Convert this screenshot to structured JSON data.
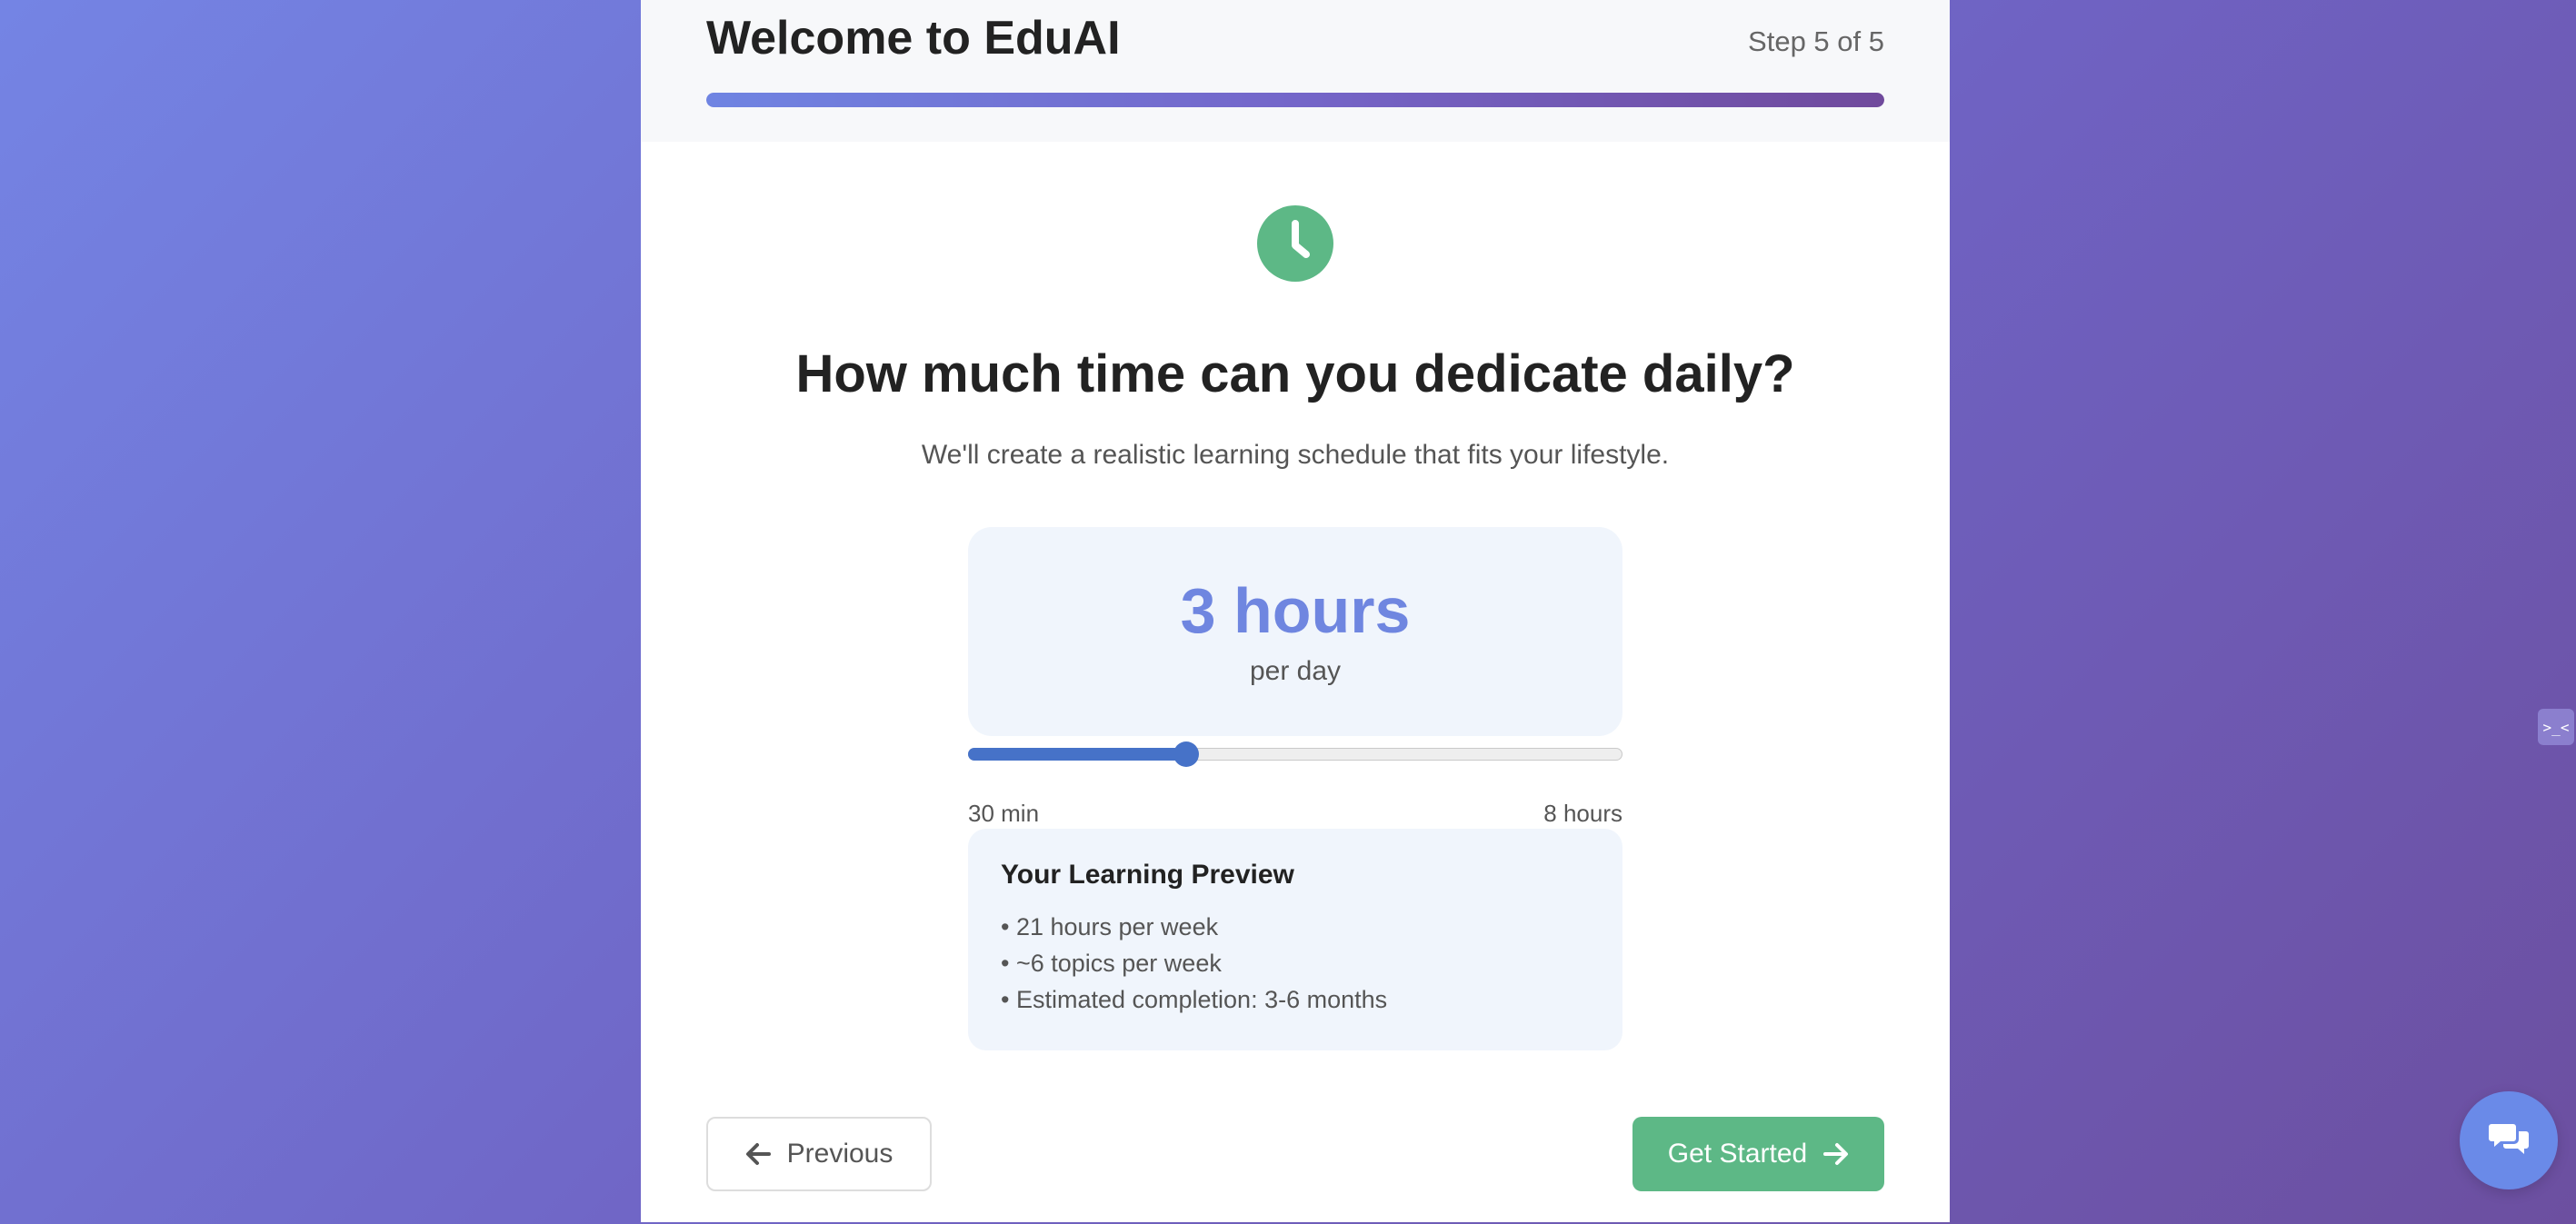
{
  "header": {
    "title": "Welcome to EduAI",
    "step_label": "Step 5 of 5",
    "progress_fraction": 1.0
  },
  "hero": {
    "icon": "clock-icon",
    "question": "How much time can you dedicate daily?",
    "subtitle": "We'll create a realistic learning schedule that fits your lifestyle."
  },
  "time_selector": {
    "value_label": "3 hours",
    "unit_label": "per day",
    "slider": {
      "min_minutes": 30,
      "max_minutes": 480,
      "value_minutes": 180
    },
    "min_label": "30 min",
    "max_label": "8 hours"
  },
  "preview": {
    "title": "Your Learning Preview",
    "items": [
      "• 21 hours per week",
      "• ~6 topics per week",
      "• Estimated completion: 3-6 months"
    ]
  },
  "navigation": {
    "previous_label": "Previous",
    "previous_icon": "arrow-left-icon",
    "next_label": "Get Started",
    "next_icon": "arrow-right-icon"
  },
  "floating": {
    "side_handle_label": ">_<",
    "chat_icon": "chat-bubbles-icon"
  },
  "colors": {
    "accent": "#6f86e0",
    "success": "#5db886",
    "slider": "#4672c8"
  }
}
